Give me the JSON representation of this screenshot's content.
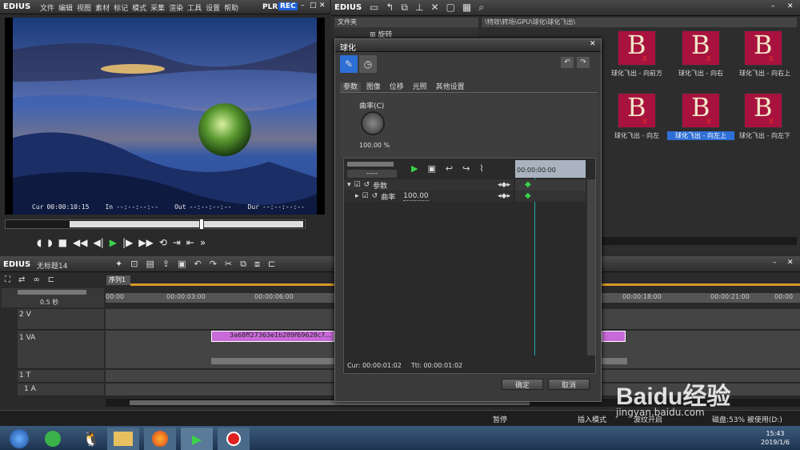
{
  "player": {
    "logo": "EDIUS",
    "menu": [
      "文件",
      "编辑",
      "视图",
      "素材",
      "标记",
      "模式",
      "采集",
      "渲染",
      "工具",
      "设置",
      "帮助"
    ],
    "plr": "PLR",
    "rec": "REC",
    "cur_label": "Cur",
    "cur": "00:00:10:15",
    "in_label": "In",
    "in": "--:--:--:--",
    "out_label": "Out",
    "out": "--:--:--:--",
    "dur_label": "Dur",
    "dur": "--:--:--:--"
  },
  "bin": {
    "logo": "EDIUS",
    "folder_header": "文件夹",
    "tree_item": "旋转",
    "path": "\\特效\\转场\\GPU\\球化\\球化飞出\\",
    "thumbs": [
      {
        "caption": "球化飞出 - 向前方"
      },
      {
        "caption": "球化飞出 - 向右"
      },
      {
        "caption": "球化飞出 - 向右上"
      },
      {
        "caption": "球化飞出 - 向左"
      },
      {
        "caption": "球化飞出 - 向左上"
      },
      {
        "caption": "球化飞出 - 向左下"
      }
    ],
    "thumb_letter": "B",
    "thumb_sub": "s"
  },
  "timeline": {
    "logo": "EDIUS",
    "project": "无标题14",
    "sequence_tab": "序列1",
    "scale": "0.5 秒",
    "ruler": [
      "00:00",
      "00:00:03:00",
      "00:00:06:00",
      "00:00:18:00",
      "00:00:21:00",
      "00:00"
    ],
    "tracks": [
      {
        "name": "2 V"
      },
      {
        "name": "1 VA"
      },
      {
        "name": "1 T"
      },
      {
        "name": "1 A"
      }
    ],
    "clip_name": "3a68ff27363e1b289f69628c7..."
  },
  "dialog": {
    "title": "球化",
    "tabs": [
      "参数",
      "图像",
      "位移",
      "光照",
      "其他设置"
    ],
    "curvature_label": "曲率(C)",
    "curvature_value": "100.00 %",
    "dropdown": "-----",
    "kf_ruler": "00:00:00:00",
    "tree": [
      {
        "label": "参数"
      },
      {
        "label": "曲率",
        "value": "100.00"
      }
    ],
    "cur_label": "Cur: 00:00:01:02",
    "ttl_label": "Ttl: 00:00:01:02",
    "ok": "确定",
    "cancel": "取消"
  },
  "status": {
    "pause": "暂停",
    "insert": "插入模式",
    "ripple": "波纹开启",
    "disk": "磁盘:53% 被使用(D:)"
  },
  "taskbar": {
    "time": "15:43",
    "date": "2019/1/6"
  },
  "watermark": {
    "text": "Baidu经验",
    "url": "jingyan.baidu.com"
  },
  "colors": {
    "accent": "#2e6fd6",
    "keyframe": "#3bd24a",
    "thumb_bg": "#a8123e",
    "rec": "#1d5fd6"
  }
}
